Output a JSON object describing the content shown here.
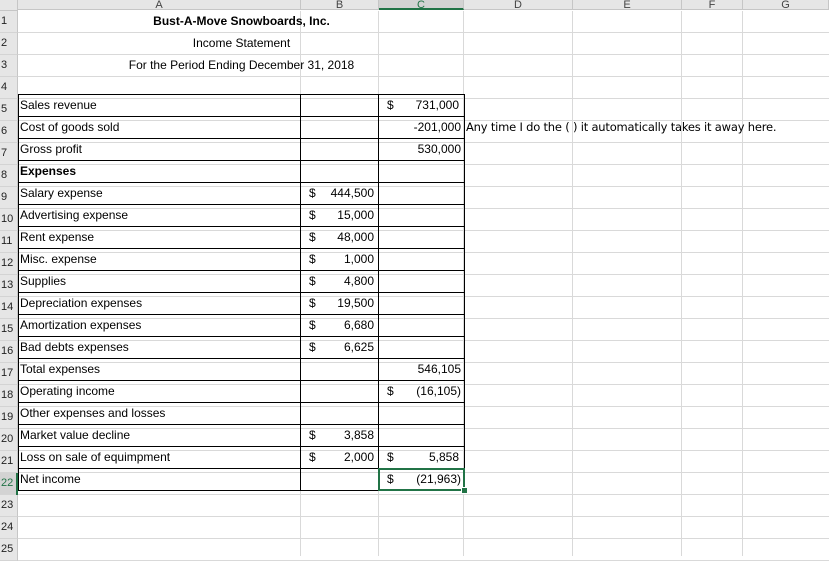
{
  "columns": [
    "A",
    "B",
    "C",
    "D",
    "E",
    "F",
    "G"
  ],
  "rows": [
    "1",
    "2",
    "3",
    "4",
    "5",
    "6",
    "7",
    "8",
    "9",
    "10",
    "11",
    "12",
    "13",
    "14",
    "15",
    "16",
    "17",
    "18",
    "19",
    "20",
    "21",
    "22",
    "23",
    "24",
    "25"
  ],
  "selected_row": "22",
  "selected_column": "C",
  "header": {
    "company": "Bust-A-Move Snowboards, Inc.",
    "statement": "Income Statement",
    "period": "For the Period Ending December 31, 2018"
  },
  "labels": {
    "r5": "Sales revenue",
    "r6": "Cost of goods sold",
    "r7": "Gross profit",
    "r8": "Expenses",
    "r9": "Salary expense",
    "r10": "Advertising expense",
    "r11": "Rent expense",
    "r12": "Misc. expense",
    "r13": "Supplies",
    "r14": "Depreciation expenses",
    "r15": "Amortization expenses",
    "r16": "Bad debts expenses",
    "r17": "Total expenses",
    "r18": "Operating income",
    "r19": "Other expenses and losses",
    "r20": "Market value decline",
    "r21": "Loss on sale of equimpment",
    "r22": "Net income"
  },
  "col_b": {
    "r9": "444,500",
    "r10": "15,000",
    "r11": "48,000",
    "r12": "1,000",
    "r13": "4,800",
    "r14": "19,500",
    "r15": "6,680",
    "r16": "6,625",
    "r20": "3,858",
    "r21": "2,000"
  },
  "col_c": {
    "r5": "731,000",
    "r6": "-201,000",
    "r7": "530,000",
    "r17": "546,105",
    "r18": "(16,105)",
    "r21": "5,858",
    "r22": "(21,963)"
  },
  "currency_symbol": "$",
  "note": "Any time I do the ( ) it automatically takes it away here."
}
